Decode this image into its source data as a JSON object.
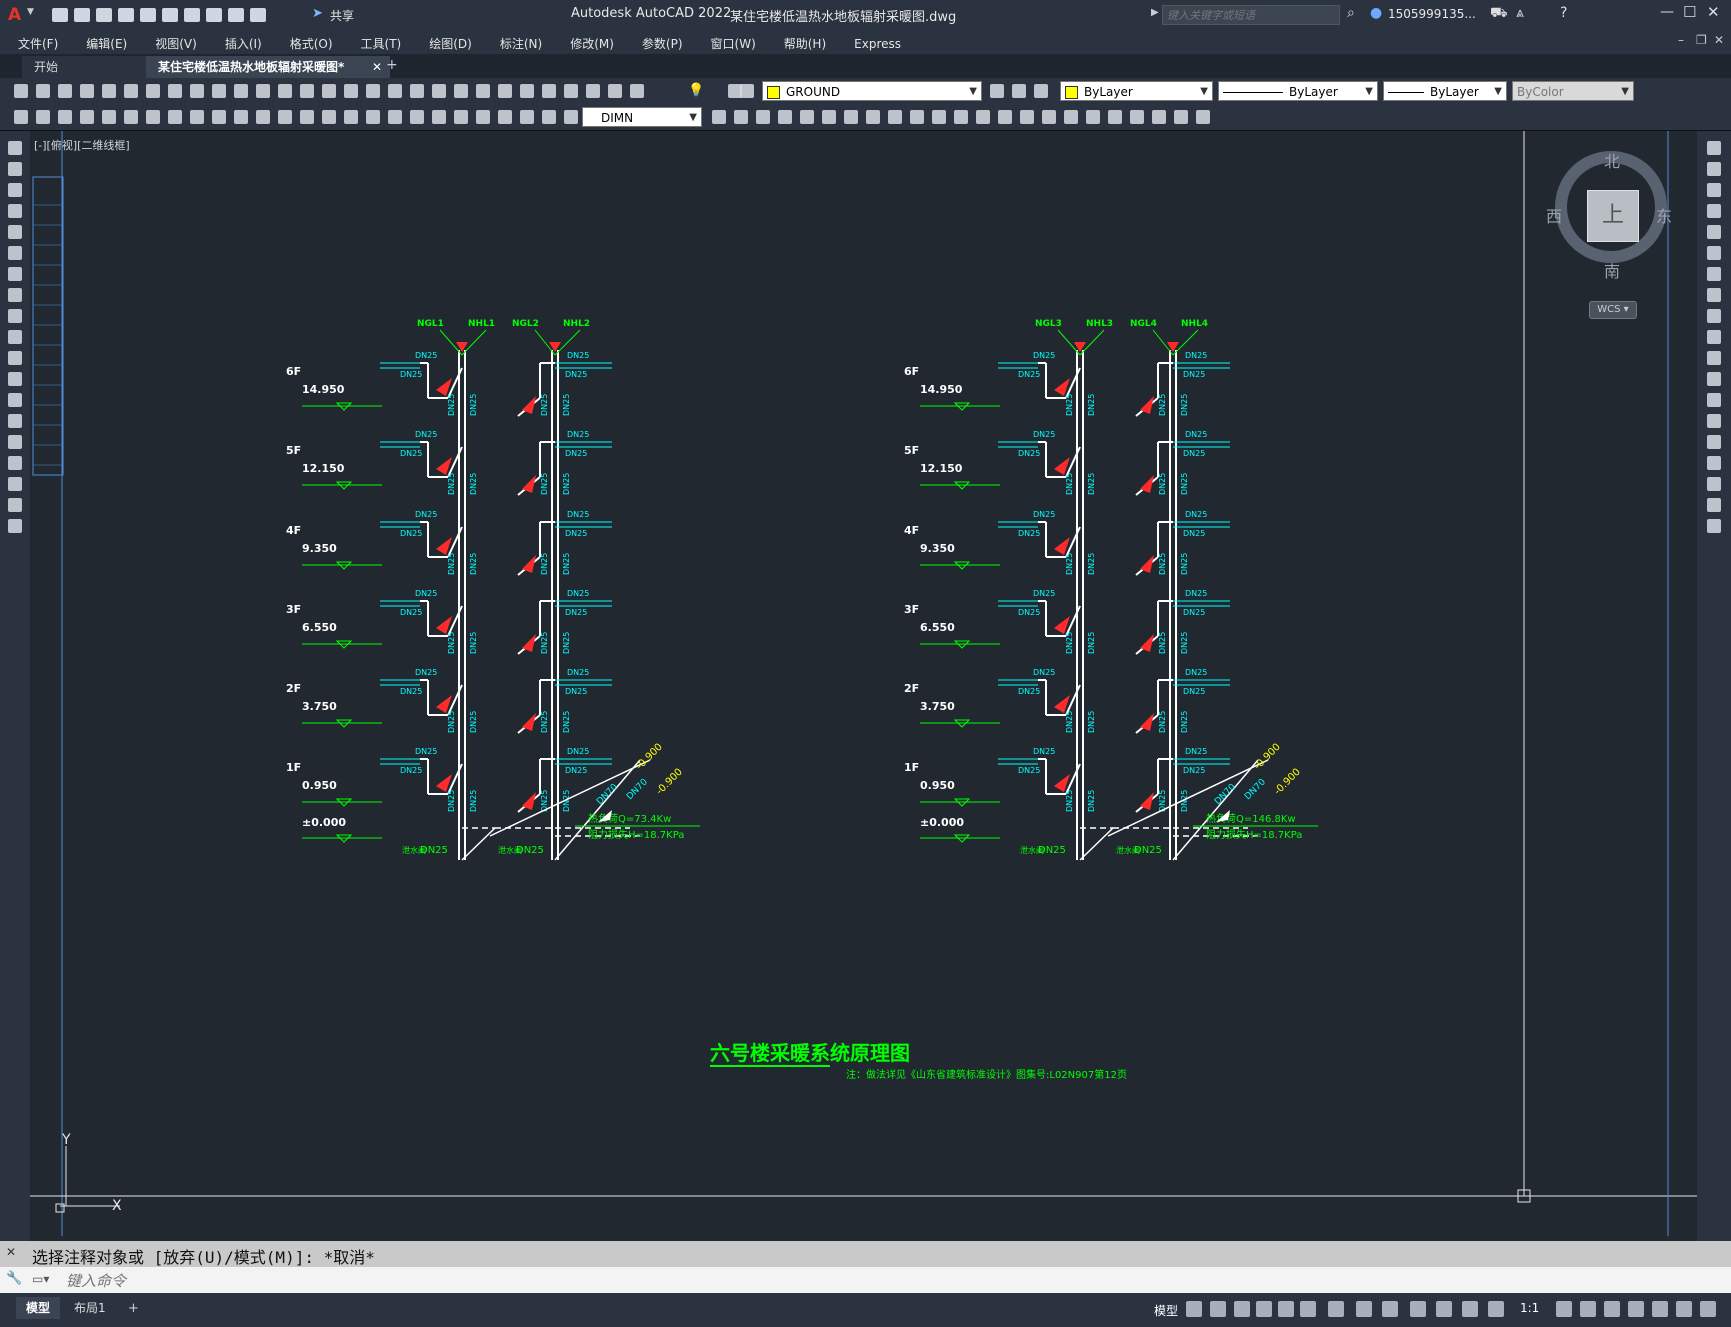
{
  "titlebar": {
    "app_title": "Autodesk AutoCAD 2022",
    "file_title": "某住宅楼低温热水地板辐射采暖图.dwg",
    "share_label": "共享",
    "search_placeholder": "键入关键字或短语",
    "user_id": "1505999135..."
  },
  "menubar": {
    "items": [
      "文件(F)",
      "编辑(E)",
      "视图(V)",
      "插入(I)",
      "格式(O)",
      "工具(T)",
      "绘图(D)",
      "标注(N)",
      "修改(M)",
      "参数(P)",
      "窗口(W)",
      "帮助(H)",
      "Express"
    ]
  },
  "tabs": {
    "start": "开始",
    "doc": "某住宅楼低温热水地板辐射采暖图*",
    "add": "+"
  },
  "toolbar": {
    "layer_value": "GROUND",
    "color_value": "ByLayer",
    "linetype_value": "ByLayer",
    "lineweight_value": "ByLayer",
    "plotstyle_value": "ByColor",
    "dimstyle_value": "DIMN"
  },
  "viewport": {
    "label": "[-][俯视][二维线框]"
  },
  "viewcube": {
    "north": "北",
    "south": "南",
    "east": "东",
    "west": "西",
    "face": "上",
    "wcs": "WCS"
  },
  "drawing": {
    "floors": [
      {
        "floor": "6F",
        "elev": "14.950"
      },
      {
        "floor": "5F",
        "elev": "12.150"
      },
      {
        "floor": "4F",
        "elev": "9.350"
      },
      {
        "floor": "3F",
        "elev": "6.550"
      },
      {
        "floor": "2F",
        "elev": "3.750"
      },
      {
        "floor": "1F",
        "elev": "0.950"
      }
    ],
    "ground_elev": "±0.000",
    "left": {
      "risers": [
        "NGL1",
        "NHL1",
        "NGL2",
        "NHL2"
      ],
      "load": "热负荷Q=73.4Kw",
      "pressure": "阻力损失H=18.7KPa"
    },
    "right": {
      "risers": [
        "NGL3",
        "NHL3",
        "NGL4",
        "NHL4"
      ],
      "load": "热负荷Q=146.8Kw",
      "pressure": "阻力损失H=18.7KPa"
    },
    "branch_size": "DN25",
    "main_size": "DN25",
    "main_label": "泄水阀",
    "pipe_in": "DN70",
    "in_elev": "-0.900",
    "title": "六号楼采暖系统原理图",
    "note": "注：做法详见《山东省建筑标准设计》图集号:L02N907第12页",
    "axis_y": "Y",
    "axis_x": "X"
  },
  "command": {
    "history": "选择注释对象或 [放弃(U)/模式(M)]: *取消*",
    "placeholder": "键入命令"
  },
  "statusbar": {
    "tab_model": "模型",
    "tab_layout": "布局1",
    "add": "+",
    "model_label": "模型",
    "scale": "1:1"
  },
  "colors": {
    "canvas": "#212830",
    "chrome": "#2b3340",
    "pipe": "#ffffff",
    "label_green": "#00ff00",
    "label_cyan": "#00ffff",
    "valve_red": "#ff2a2a"
  }
}
